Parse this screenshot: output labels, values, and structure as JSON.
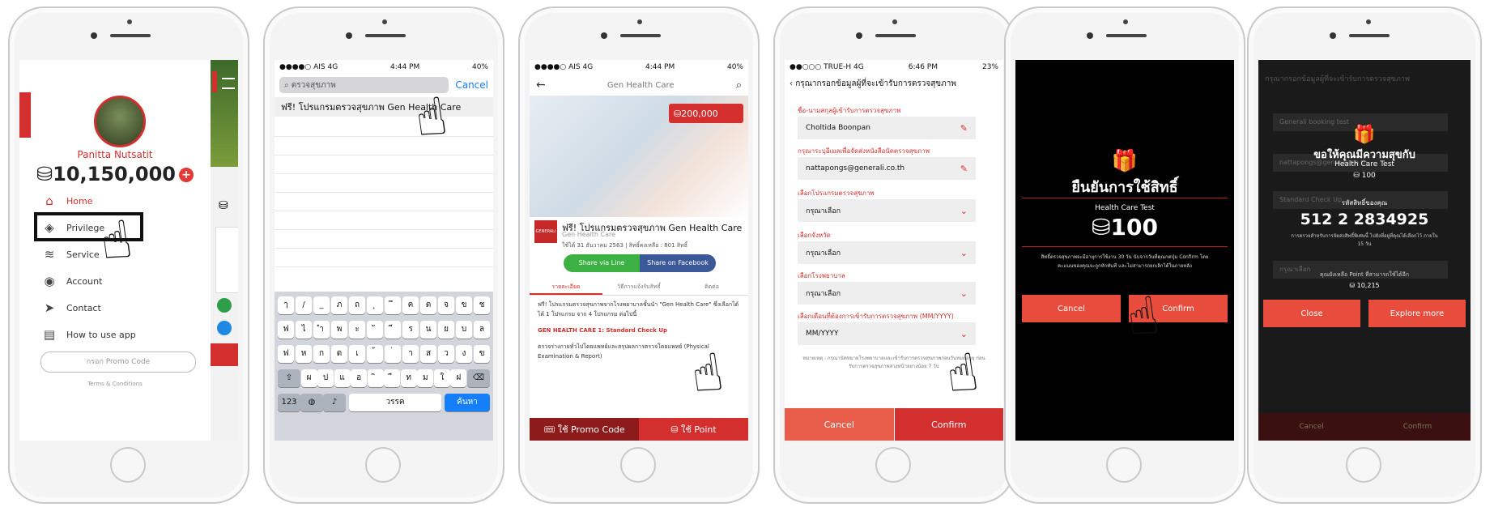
{
  "screen1": {
    "user_name": "Panitta Nutsatit",
    "points": "10,150,000",
    "coin_icon": "⛁",
    "menu": [
      {
        "icon": "home-icon",
        "label": "Home"
      },
      {
        "icon": "tag-icon",
        "label": "Privilege"
      },
      {
        "icon": "service-icon",
        "label": "Service"
      },
      {
        "icon": "account-icon",
        "label": "Account"
      },
      {
        "icon": "send-icon",
        "label": "Contact"
      },
      {
        "icon": "book-icon",
        "label": "How to use app"
      }
    ],
    "promo_placeholder": "กรอก Promo Code",
    "terms": "Terms & Conditions"
  },
  "screen2": {
    "status": {
      "carrier": "●●●●○ AIS  4G",
      "time": "4:44 PM",
      "battery": "40%"
    },
    "search_value": "ตรวจสุขภาพ",
    "cancel": "Cancel",
    "result": "ฟรี! โปรแกรมตรวจสุขภาพ Gen Health Care",
    "keys_row1": [
      "ๅ",
      "/",
      "_",
      "ภ",
      "ถ",
      "ุ",
      "ึ",
      "ค",
      "ต",
      "จ",
      "ข",
      "ช"
    ],
    "keys_row2": [
      "ฟ",
      "ไ",
      "ำ",
      "พ",
      "ะ",
      "ั",
      "ี",
      "ร",
      "น",
      "ย",
      "บ",
      "ล"
    ],
    "keys_row3": [
      "ฟ",
      "ห",
      "ก",
      "ด",
      "เ",
      "้",
      "่",
      "า",
      "ส",
      "ว",
      "ง",
      "ข"
    ],
    "keys_row4": [
      "ผ",
      "ป",
      "แ",
      "อ",
      "ิ",
      "ื",
      "ท",
      "ม",
      "ใ",
      "ฝ"
    ],
    "key_numbers": "123",
    "key_space": "วรรค",
    "key_return": "ค้นหา"
  },
  "screen3": {
    "status": {
      "carrier": "●●●●○ AIS  4G",
      "time": "4:44 PM",
      "battery": "40%"
    },
    "nav_title": "Gen Health Care",
    "price": "200,000",
    "title": "ฟรี! โปรแกรมตรวจสุขภาพ Gen Health Care",
    "subtitle": "Gen Health Care",
    "date": "ใช้ได้ 31 ธันวาคม 2563 | สิทธิ์คงเหลือ : 801 สิทธิ์",
    "share_line": "Share via Line",
    "share_fb": "Share on Facebook",
    "tabs": [
      "รายละเอียด",
      "วิธีการแจ้งรับสิทธิ์",
      "ติดต่อ"
    ],
    "desc1": "ฟรี! โปรแกรมตรวจสุขภาพจากโรงพยาบาลชั้นนำ \"Gen Health Care\" ซึ่งเลือกได้ได้ 1 โปรแกรม จาก 4 โปรแกรม ต่อไปนี้",
    "desc_red": "GEN HEALTH CARE 1: Standard Check Up",
    "desc2": "ตรวจร่างกายทั่วไปโดยแพทย์และสรุปผลการตรวจโดยแพทย์ (Physical Examination & Report)",
    "btn_promo": "ใช้ Promo Code",
    "btn_point": "ใช้ Point"
  },
  "screen4": {
    "status": {
      "carrier": "●●○○○ TRUE-H  4G",
      "time": "6:46 PM",
      "battery": "23%"
    },
    "header": "กรุณากรอกข้อมูลผู้ที่จะเข้ารับการตรวจสุขภาพ",
    "fields": [
      {
        "label": "ชื่อ-นามสกุลผู้เข้ารับการตรวจสุขภาพ",
        "value": "Choltida Boonpan",
        "editable": true
      },
      {
        "label": "กรุณาระบุอีเมลเพื่อจัดส่งหนังสือนัดตรวจสุขภาพ",
        "value": "nattapongs@generali.co.th",
        "editable": true
      },
      {
        "label": "เลือกโปรแกรมตรวจสุขภาพ",
        "value": "กรุณาเลือก",
        "editable": false
      },
      {
        "label": "เลือกจังหวัด",
        "value": "กรุณาเลือก",
        "editable": false
      },
      {
        "label": "เลือกโรงพยาบาล",
        "value": "กรุณาเลือก",
        "editable": false
      },
      {
        "label": "เลือกเดือนที่ต้องการเข้ารับการตรวจสุขภาพ (MM/YYYY)",
        "value": "MM/YYYY",
        "editable": false
      }
    ],
    "note": "หมายเหตุ : กรุณานัดหมายโรงพยาบาลและเข้ารับการตรวจสุขภาพก่อนวันหมดอายุ ก่อนรับการตรวจสุขภาพล่วงหน้าอย่างน้อย 7 วัน",
    "cancel": "Cancel",
    "confirm": "Confirm"
  },
  "screen5": {
    "title": "ยืนยันการใช้สิทธิ์",
    "item": "Health Care Test",
    "points": "100",
    "desc": "สิทธิ์ตรวจสุขภาพจะมีอายุการใช้งาน 30 วัน นับจากวันที่คุณกดปุ่ม Confirm โดยคะแนนของคุณจะถูกหักทันที และไม่สามารถยกเลิกได้ในภายหลัง",
    "cancel": "Cancel",
    "confirm": "Confirm"
  },
  "screen6": {
    "bg_header": "กรุณากรอกข้อมูลผู้ที่จะเข้ารับการตรวจสุขภาพ",
    "bg_field1": "Generali booking test",
    "bg_field2": "nattapongs@generali.co.th",
    "bg_field3": "Standard Check Up",
    "bg_field4": "กรุณาเลือก",
    "bg_cancel": "Cancel",
    "bg_confirm": "Confirm",
    "title": "ขอให้คุณมีความสุขกับ",
    "item": "Health Care Test",
    "points": "100",
    "code_label": "รหัสสิทธิ์ของคุณ",
    "code": "512 2 2834925",
    "code_note": "การตรวจสำหรับการจัดส่งสิทธิ์พิเศษนี้ ไปยังที่อยู่ที่คุณได้เลือกไว้ ภายใน 15 วัน",
    "remaining_label": "คุณยังเหลือ Point ที่สามารถใช้ได้อีก",
    "remaining": "10,215",
    "close": "Close",
    "explore": "Explore more"
  }
}
